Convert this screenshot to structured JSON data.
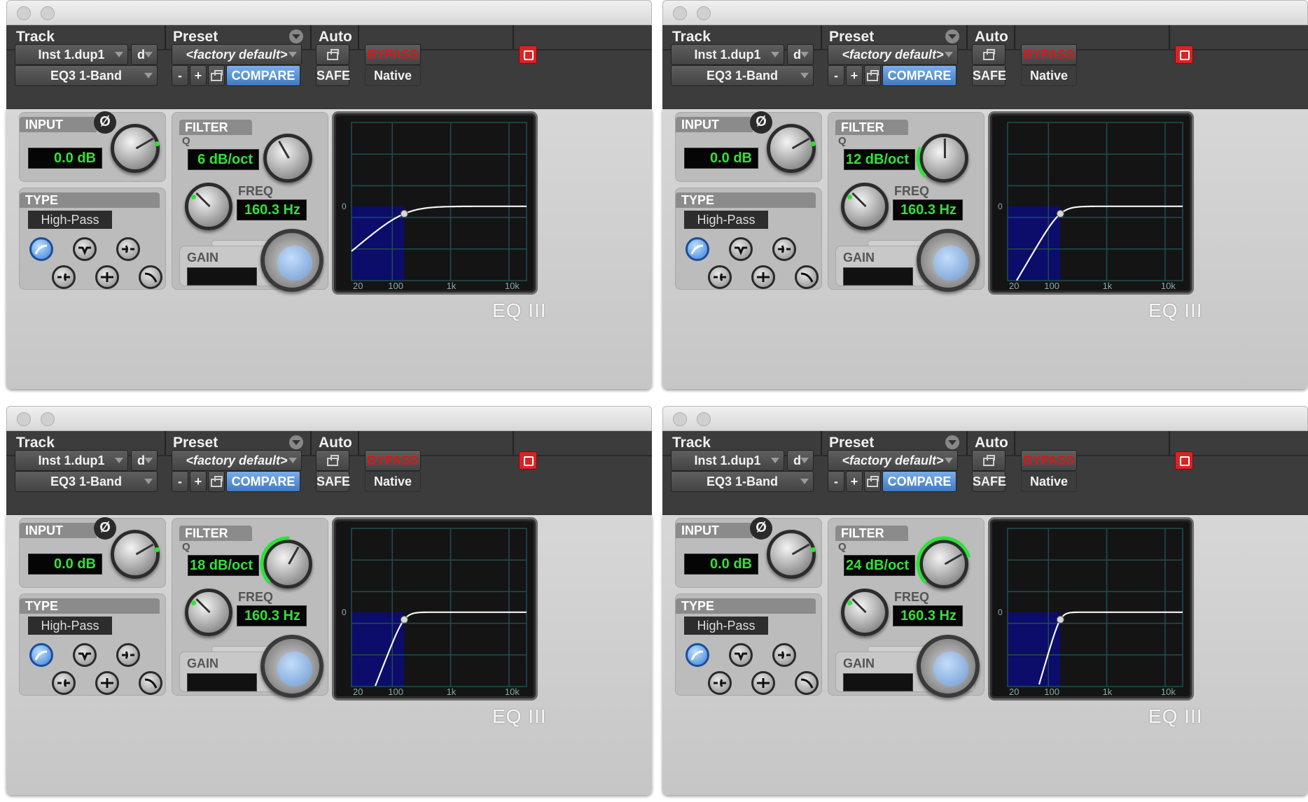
{
  "plugins": [
    {
      "header": {
        "track_label": "Track",
        "preset_label": "Preset",
        "auto_label": "Auto",
        "track_name": "Inst 1.dup1",
        "track_group": "d",
        "plugin_name": "EQ3 1-Band",
        "preset_name": "<factory default>",
        "minus_label": "-",
        "plus_label": "+",
        "compare_label": "COMPARE",
        "bypass_label": "BYPASS",
        "safe_label": "SAFE",
        "native_label": "Native"
      },
      "input": {
        "title": "INPUT",
        "phase_symbol": "Ø",
        "value": "0.0 dB"
      },
      "type": {
        "title": "TYPE",
        "value": "High-Pass"
      },
      "filter": {
        "title": "FILTER",
        "q_label": "Q",
        "q_value": "6 dB/oct",
        "freq_label": "FREQ",
        "freq_value": "160.3 Hz",
        "gain_label": "GAIN",
        "q_level": 0.0
      },
      "graph": {
        "zero_label": "0",
        "x_labels": [
          "20",
          "100",
          "1k",
          "10k"
        ],
        "slope_db_per_oct": 6
      },
      "logo": "EQ III"
    },
    {
      "header": {
        "track_label": "Track",
        "preset_label": "Preset",
        "auto_label": "Auto",
        "track_name": "Inst 1.dup1",
        "track_group": "d",
        "plugin_name": "EQ3 1-Band",
        "preset_name": "<factory default>",
        "minus_label": "-",
        "plus_label": "+",
        "compare_label": "COMPARE",
        "bypass_label": "BYPASS",
        "safe_label": "SAFE",
        "native_label": "Native"
      },
      "input": {
        "title": "INPUT",
        "phase_symbol": "Ø",
        "value": "0.0 dB"
      },
      "type": {
        "title": "TYPE",
        "value": "High-Pass"
      },
      "filter": {
        "title": "FILTER",
        "q_label": "Q",
        "q_value": "12 dB/oct",
        "freq_label": "FREQ",
        "freq_value": "160.3 Hz",
        "gain_label": "GAIN",
        "q_level": 0.33
      },
      "graph": {
        "zero_label": "0",
        "x_labels": [
          "20",
          "100",
          "1k",
          "10k"
        ],
        "slope_db_per_oct": 12
      },
      "logo": "EQ III"
    },
    {
      "header": {
        "track_label": "Track",
        "preset_label": "Preset",
        "auto_label": "Auto",
        "track_name": "Inst 1.dup1",
        "track_group": "d",
        "plugin_name": "EQ3 1-Band",
        "preset_name": "<factory default>",
        "minus_label": "-",
        "plus_label": "+",
        "compare_label": "COMPARE",
        "bypass_label": "BYPASS",
        "safe_label": "SAFE",
        "native_label": "Native"
      },
      "input": {
        "title": "INPUT",
        "phase_symbol": "Ø",
        "value": "0.0 dB"
      },
      "type": {
        "title": "TYPE",
        "value": "High-Pass"
      },
      "filter": {
        "title": "FILTER",
        "q_label": "Q",
        "q_value": "18 dB/oct",
        "freq_label": "FREQ",
        "freq_value": "160.3 Hz",
        "gain_label": "GAIN",
        "q_level": 0.66
      },
      "graph": {
        "zero_label": "0",
        "x_labels": [
          "20",
          "100",
          "1k",
          "10k"
        ],
        "slope_db_per_oct": 18
      },
      "logo": "EQ III"
    },
    {
      "header": {
        "track_label": "Track",
        "preset_label": "Preset",
        "auto_label": "Auto",
        "track_name": "Inst 1.dup1",
        "track_group": "d",
        "plugin_name": "EQ3 1-Band",
        "preset_name": "<factory default>",
        "minus_label": "-",
        "plus_label": "+",
        "compare_label": "COMPARE",
        "bypass_label": "BYPASS",
        "safe_label": "SAFE",
        "native_label": "Native"
      },
      "input": {
        "title": "INPUT",
        "phase_symbol": "Ø",
        "value": "0.0 dB"
      },
      "type": {
        "title": "TYPE",
        "value": "High-Pass"
      },
      "filter": {
        "title": "FILTER",
        "q_label": "Q",
        "q_value": "24 dB/oct",
        "freq_label": "FREQ",
        "freq_value": "160.3 Hz",
        "gain_label": "GAIN",
        "q_level": 1.0
      },
      "graph": {
        "zero_label": "0",
        "x_labels": [
          "20",
          "100",
          "1k",
          "10k"
        ],
        "slope_db_per_oct": 24
      },
      "logo": "EQ III"
    }
  ],
  "colors": {
    "lcd_text": "#34e03a",
    "compare_bg": "#4a86d0",
    "bypass_text": "#d21a1a",
    "graph_fill": "#0c0c6a",
    "power": "#d82424"
  }
}
